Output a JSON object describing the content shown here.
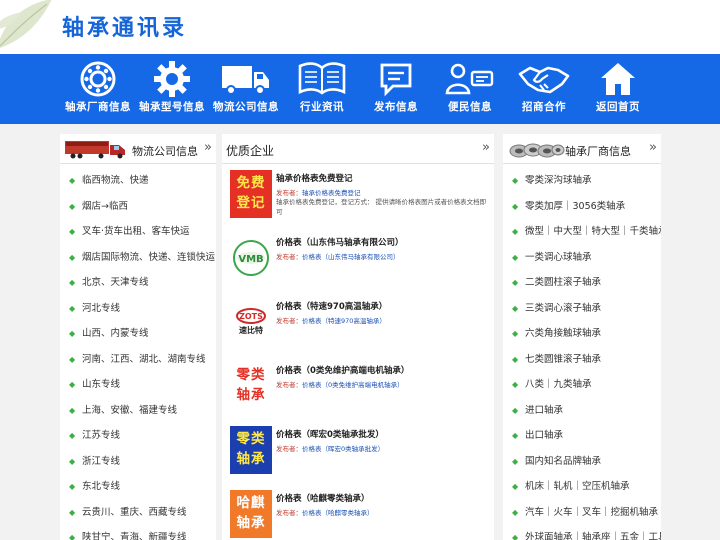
{
  "site": {
    "logo_text": "轴承通讯录"
  },
  "nav": [
    {
      "label": "轴承厂商信息",
      "icon": "bearing-icon"
    },
    {
      "label": "轴承型号信息",
      "icon": "gear-icon"
    },
    {
      "label": "物流公司信息",
      "icon": "truck-icon"
    },
    {
      "label": "行业资讯",
      "icon": "book-icon"
    },
    {
      "label": "发布信息",
      "icon": "message-icon"
    },
    {
      "label": "便民信息",
      "icon": "person-card-icon"
    },
    {
      "label": "招商合作",
      "icon": "handshake-icon"
    },
    {
      "label": "返回首页",
      "icon": "home-icon"
    }
  ],
  "left": {
    "title": "物流公司信息",
    "more": "»",
    "items": [
      "临西物流、快递",
      "烟店→临西",
      "叉车·货车出租、客车快运",
      "烟店国际物流、快递、连锁快运",
      "北京、天津专线",
      "河北专线",
      "山西、内蒙专线",
      "河南、江西、湖北、湖南专线",
      "山东专线",
      "上海、安徽、福建专线",
      "江苏专线",
      "浙江专线",
      "东北专线",
      "云贵川、重庆、西藏专线",
      "陕甘宁、青海、新疆专线"
    ]
  },
  "middle": {
    "title": "优质企业",
    "more": "»",
    "publisher_label": "发布者：",
    "entries": [
      {
        "title": "轴承价格表免费登记",
        "publisher": "轴承价格表免费登记",
        "desc": "轴承价格表免费登记，登记方式： 提供请晰价格表图片或者价格表文档即可",
        "thumb_text": "免费登记",
        "thumb_color": "#e53125",
        "thumb_text_color": "#ffe74a"
      },
      {
        "title": "价格表（山东伟马轴承有限公司）",
        "publisher": "价格表（山东伟马轴承有限公司）",
        "desc": "",
        "thumb_logo": "VMB",
        "thumb_color": "#ffffff"
      },
      {
        "title": "价格表（特速970高温轴承）",
        "publisher": "价格表（特速970高温轴承）",
        "desc": "",
        "thumb_logo": "速比特",
        "thumb_color": "#ffffff"
      },
      {
        "title": "价格表（0类免维护高端电机轴承）",
        "publisher": "价格表（0类免维护高端电机轴承）",
        "desc": "",
        "thumb_text": "零类轴承",
        "thumb_color": "#ffffff",
        "thumb_text_color": "#e53125"
      },
      {
        "title": "价格表（晖宏0类轴承批发）",
        "publisher": "价格表（晖宏0类轴承批发）",
        "desc": "",
        "thumb_text": "零类轴承",
        "thumb_color": "#1b3fae",
        "thumb_text_color": "#ffe74a"
      },
      {
        "title": "价格表（哈麒零类轴承）",
        "publisher": "价格表（哈麒零类轴承）",
        "desc": "",
        "thumb_text": "哈麒轴承",
        "thumb_color": "#f07a2a",
        "thumb_text_color": "#ffffff"
      }
    ]
  },
  "right": {
    "title": "轴承厂商信息",
    "more": "»",
    "items": [
      "零类深沟球轴承",
      "零类加厚｜3056类轴承",
      "微型｜中大型｜特大型｜千类轴承",
      "一类调心球轴承",
      "二类圆柱滚子轴承",
      "三类调心滚子轴承",
      "六类角接触球轴承",
      "七类圆锥滚子轴承",
      "八类｜九类轴承",
      "进口轴承",
      "出口轴承",
      "国内知名品牌轴承",
      "机床｜轧机｜空压机轴承",
      "汽车｜火车｜叉车｜挖掘机轴承",
      "外球面轴承｜轴承座｜五金｜工具"
    ]
  },
  "colors": {
    "nav_bg": "#1669e6",
    "logo": "#1565d8",
    "bullet": "#3cb043",
    "publisher": "#c0392b"
  }
}
